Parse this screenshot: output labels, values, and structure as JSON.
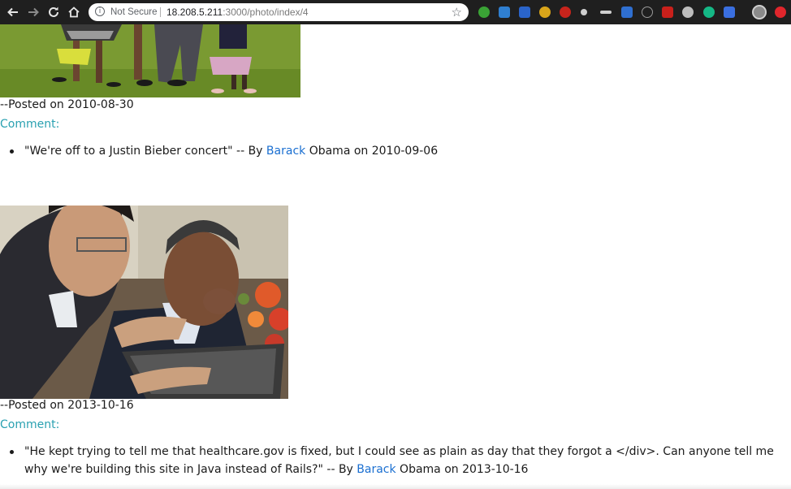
{
  "browser": {
    "not_secure_label": "Not Secure",
    "url_host": "18.208.5.211",
    "url_path": ":3000/photo/index/4"
  },
  "photos": [
    {
      "posted_label": "--Posted on 2010-08-30",
      "comment_heading": "Comment:",
      "comments": [
        {
          "quote": "\"We're off to a Justin Bieber concert\" -- By ",
          "author_first": "Barack",
          "suffix": " Obama on 2010-09-06"
        }
      ]
    },
    {
      "posted_label": "--Posted on 2013-10-16",
      "comment_heading": "Comment:",
      "comments": [
        {
          "quote": "\"He kept trying to tell me that healthcare.gov is fixed, but I could see as plain as day that they forgot a </div>. Can anyone tell me why we're building this site in Java instead of Rails?\" -- By ",
          "author_first": "Barack",
          "suffix": " Obama on 2013-10-16"
        }
      ]
    }
  ],
  "colors": {
    "link": "#1a6fd1",
    "comment_heading": "#2aa1b1",
    "chrome_bar": "#1f1f1f"
  },
  "icons": {
    "back": "back-arrow-icon",
    "forward": "forward-arrow-icon",
    "reload": "reload-icon",
    "home": "home-icon",
    "info": "info-icon",
    "bookmark": "star-icon"
  }
}
